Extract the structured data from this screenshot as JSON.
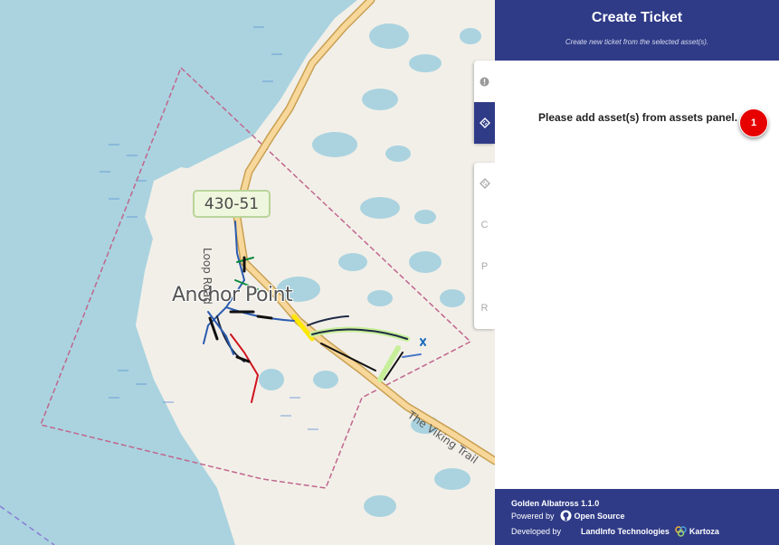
{
  "map": {
    "town_label": "Anchor Point",
    "route_label": "430-51",
    "loop_road_label": "Loop Road",
    "viking_trail_label": "The Viking Trail"
  },
  "rail": {
    "top_items": [
      {
        "icon": "info-icon",
        "active": false
      },
      {
        "icon": "ticket-icon",
        "active": true
      }
    ],
    "bottom_items": [
      {
        "icon": "ticket-icon"
      },
      {
        "label": "C"
      },
      {
        "label": "P"
      },
      {
        "label": "R"
      }
    ]
  },
  "panel": {
    "title": "Create Ticket",
    "subtitle": "Create new ticket from the selected asset(s).",
    "message": "Please add asset(s) from assets panel.",
    "badge": "1",
    "footer": {
      "app": "Golden Albatross 1.1.0",
      "powered_by": "Powered by",
      "open_source": "Open Source",
      "developed_by": "Developed by",
      "landinfo": "LandInfo Technologies",
      "kartoza": "Kartoza"
    }
  },
  "colors": {
    "header": "#2f3b87",
    "badge": "#e60000",
    "water": "#aad3df",
    "land": "#f2efe9"
  }
}
